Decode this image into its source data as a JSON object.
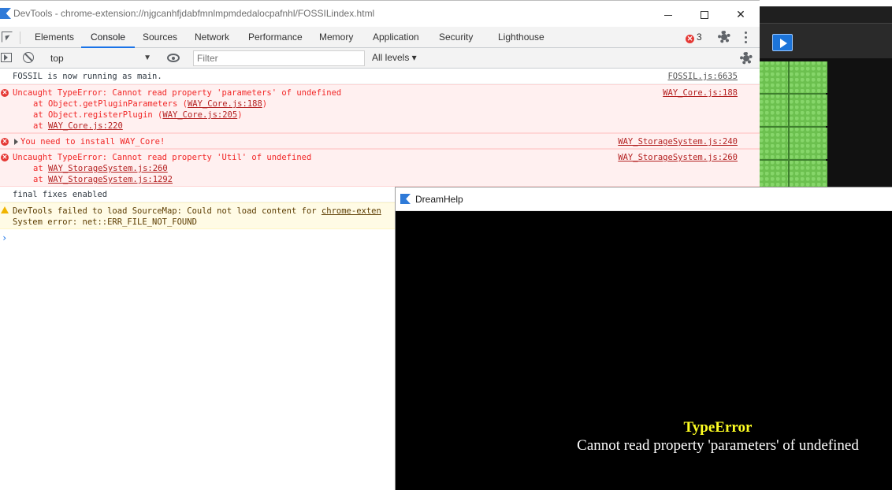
{
  "devtools": {
    "title": "DevTools - chrome-extension://njgcanhfjdabfmnlmpmdedalocpafnhl/FOSSILindex.html",
    "tabs": [
      "Elements",
      "Console",
      "Sources",
      "Network",
      "Performance",
      "Memory",
      "Application",
      "Security",
      "Lighthouse"
    ],
    "active_tab": "Console",
    "error_count": "3",
    "context": "top",
    "filter_placeholder": "Filter",
    "levels_label": "All levels ▾"
  },
  "console": {
    "messages": [
      {
        "type": "info",
        "text": "FOSSIL is now running as main.",
        "source": "FOSSIL.js:6635"
      },
      {
        "type": "error",
        "text": "Uncaught TypeError: Cannot read property 'parameters' of undefined",
        "source": "WAY_Core.js:188",
        "stack": [
          "at Object.getPluginParameters (",
          "WAY_Core.js:188",
          ")",
          "at Object.registerPlugin (",
          "WAY_Core.js:205",
          ")",
          "at ",
          "WAY_Core.js:220"
        ]
      },
      {
        "type": "error",
        "text": "You need to install WAY_Core!",
        "source": "WAY_StorageSystem.js:240"
      },
      {
        "type": "error",
        "text": "Uncaught TypeError: Cannot read property 'Util' of undefined",
        "source": "WAY_StorageSystem.js:260",
        "stack": [
          "at ",
          "WAY_StorageSystem.js:260",
          "at ",
          "WAY_StorageSystem.js:1292"
        ]
      },
      {
        "type": "info",
        "text": "final fixes enabled"
      },
      {
        "type": "warning",
        "text": "DevTools failed to load SourceMap: Could not load content for ",
        "link": "chrome-exten",
        "text2": "System error: net::ERR_FILE_NOT_FOUND"
      }
    ],
    "prompt": "›"
  },
  "dreamhelp": {
    "title": "DreamHelp",
    "error_type": "TypeError",
    "error_message": "Cannot read property 'parameters' of undefined"
  },
  "colors": {
    "error_text": "#f12727",
    "error_bg": "#fff0f0",
    "warn_bg": "#fffbe5",
    "accent": "#1a73e8",
    "error_type_text": "#ffff22"
  },
  "icons": [
    "inspect-icon",
    "sidebar-toggle-icon",
    "clear-console-icon",
    "eye-icon",
    "gear-icon",
    "more-vert-icon",
    "error-icon",
    "warning-icon",
    "play-icon",
    "app-icon"
  ]
}
